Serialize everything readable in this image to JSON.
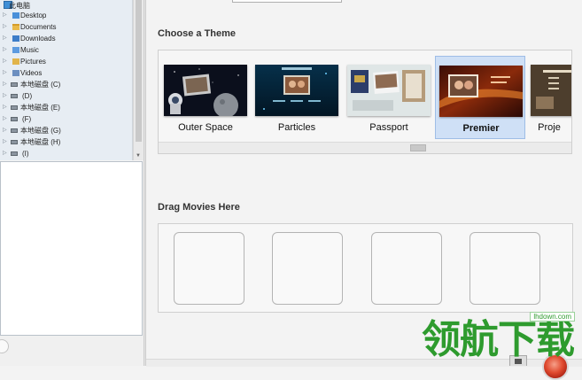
{
  "tree": {
    "items": [
      {
        "label": "此电脑",
        "icon": "computer-icon"
      },
      {
        "label": "Desktop",
        "icon": "desktop-folder-icon"
      },
      {
        "label": "Documents",
        "icon": "documents-folder-icon"
      },
      {
        "label": "Downloads",
        "icon": "downloads-folder-icon"
      },
      {
        "label": "Music",
        "icon": "music-folder-icon"
      },
      {
        "label": "Pictures",
        "icon": "pictures-folder-icon"
      },
      {
        "label": "Videos",
        "icon": "videos-folder-icon"
      },
      {
        "label": "本地磁盘 (C)",
        "icon": "drive-icon"
      },
      {
        "label": "(D)",
        "icon": "drive-icon"
      },
      {
        "label": "本地磁盘 (E)",
        "icon": "drive-icon"
      },
      {
        "label": "(F)",
        "icon": "drive-icon"
      },
      {
        "label": "本地磁盘 (G)",
        "icon": "drive-icon"
      },
      {
        "label": "本地磁盘 (H)",
        "icon": "drive-icon"
      },
      {
        "label": "(I)",
        "icon": "drive-icon"
      }
    ]
  },
  "themes": {
    "title": "Choose a Theme",
    "selected": "Premier",
    "items": [
      {
        "name": "Outer Space"
      },
      {
        "name": "Particles"
      },
      {
        "name": "Passport"
      },
      {
        "name": "Premier"
      },
      {
        "name": "Proje"
      }
    ]
  },
  "drag": {
    "title": "Drag Movies Here",
    "slot_count": 4
  },
  "watermark": {
    "text": "领航下载",
    "url": "lhdown.com"
  },
  "colors": {
    "selected_bg": "#cfe0f6",
    "selected_border": "#9ebde6",
    "watermark_green": "#2e9b2e",
    "tree_bg": "#e7edf3"
  }
}
